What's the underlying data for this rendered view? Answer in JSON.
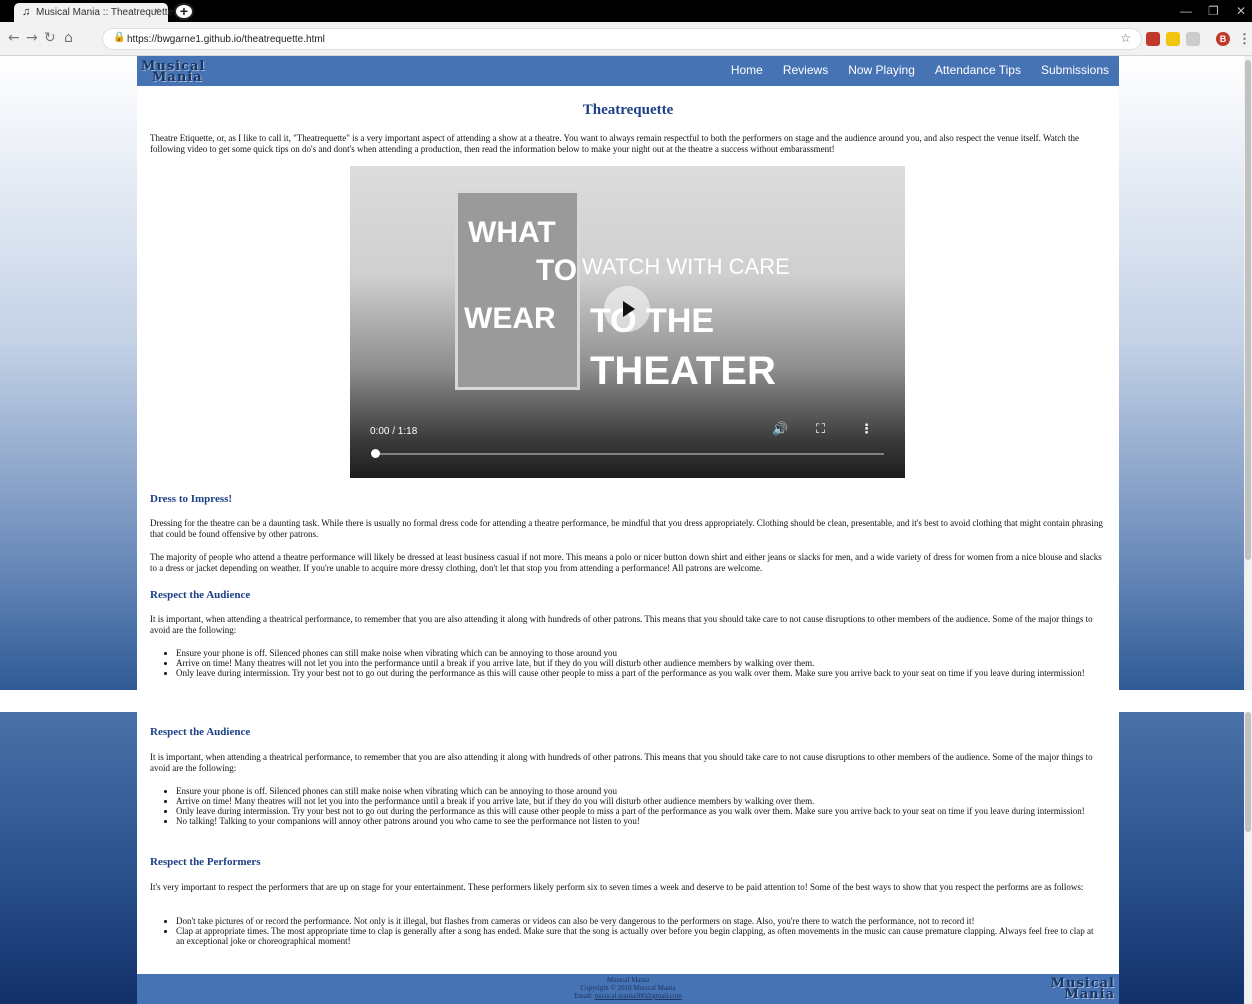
{
  "browser": {
    "tab_title": "Musical Mania :: Theatrequette",
    "tab_close": "×",
    "new_tab": "+",
    "url": "https://bwgarne1.github.io/theatrequette.html",
    "profile_initial": "B"
  },
  "site": {
    "logo_line1": "Musical",
    "logo_line2": "Mania",
    "nav": [
      "Home",
      "Reviews",
      "Now Playing",
      "Attendance Tips",
      "Submissions"
    ]
  },
  "page": {
    "title": "Theatrequette",
    "intro": "Theatre Etiquette, or, as I like to call it, \"Theatrequette\" is a very important aspect of attending a show at a theatre. You want to always remain respectful to both the performers on stage and the audience around you, and also respect the venue itself. Watch the following video to get some quick tips on do's and dont's when attending a production, then read the information below to make your night out at the theatre a success without embarassment!",
    "video": {
      "card_text": [
        "WHAT",
        "TO",
        "WEAR"
      ],
      "overlay_line1": "WATCH WITH CARE",
      "overlay_line2": "TO THE",
      "overlay_line3": "THEATER",
      "time": "0:00 / 1:18"
    },
    "dress": {
      "heading": "Dress to Impress!",
      "p1": "Dressing for the theatre can be a daunting task. While there is usually no formal dress code for attending a theatre performance, be mindful that you dress appropriately. Clothing should be clean, presentable, and it's best to avoid clothing that might contain phrasing that could be found offensive by other patrons.",
      "p2": "The majority of people who attend a theatre performance will likely be dressed at least business casual if not more. This means a polo or nicer button down shirt and either jeans or slacks for men, and a wide variety of dress for women from a nice blouse and slacks to a dress or jacket depending on weather. If you're unable to acquire more dressy clothing, don't let that stop you from attending a performance! All patrons are welcome."
    },
    "audience": {
      "heading": "Respect the Audience",
      "p": "It is important, when attending a theatrical performance, to remember that you are also attending it along with hundreds of other patrons. This means that you should take care to not cause disruptions to other members of the audience. Some of the major things to avoid are the following:",
      "items": [
        "Ensure your phone is off. Silenced phones can still make noise when vibrating which can be annoying to those around you",
        "Arrive on time! Many theatres will not let you into the performance until a break if you arrive late, but if they do you will disturb other audience members by walking over them.",
        "Only leave during intermission. Try your best not to go out during the performance as this will cause other people to miss a part of the performance as you walk over them. Make sure you arrive back to your seat on time if you leave during intermission!",
        "No talking! Talking to your companions will annoy other patrons around you who came to see the performance not listen to you!"
      ]
    },
    "performers": {
      "heading": "Respect the Performers",
      "p": "It's very important to respect the performers that are up on stage for your entertainment. These performers likely perform six to seven times a week and deserve to be paid attention to! Some of the best ways to show that you respect the performs are as follows:",
      "items": [
        "Don't take pictures of or record the performance. Not only is it illegal, but flashes from cameras or videos can also be very dangerous to the performers on stage. Also, you're there to watch the performance, not to record it!",
        "Clap at appropriate times. The most appropriate time to clap is generally after a song has ended. Make sure that the song is actually over before you begin clapping, as often movements in the music can cause premature clapping. Always feel free to clap at an exceptional joke or choreographical moment!"
      ]
    },
    "footer": {
      "line1": "Musical Mania",
      "line2": "Copyright © 2018 Musical Mania",
      "email_label": "Email:",
      "email": "musical.mania300@gmail.com"
    }
  }
}
